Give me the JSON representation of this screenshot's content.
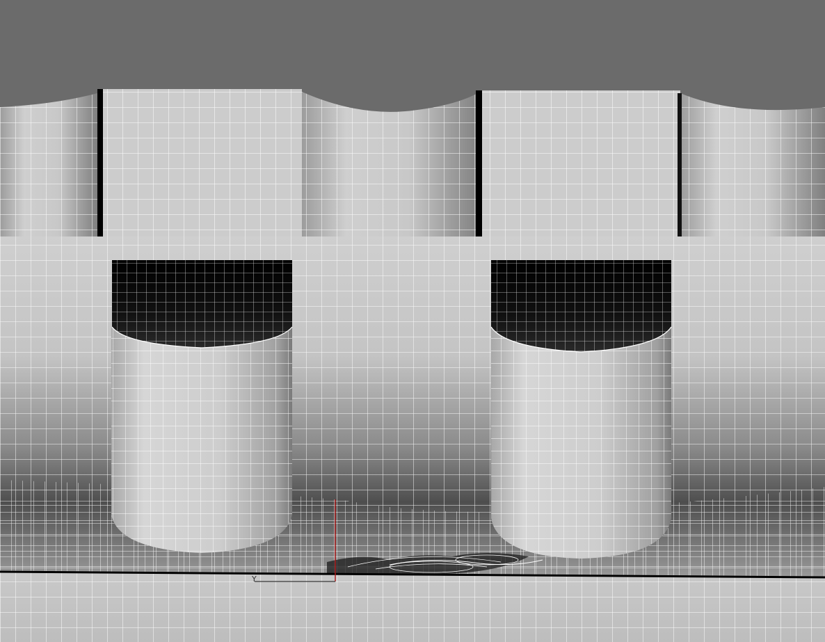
{
  "scene": {
    "colors": {
      "background": "#6b6b6b",
      "surface_light": "#d2d2d2",
      "surface_mid": "#bdbdbd",
      "surface_dark": "#5a5a5a",
      "shadow": "#000000",
      "mesh_lines": "#ffffff",
      "axis_vertical": "#b01818",
      "axis_horizontal": "#3a3a3a"
    },
    "cylinders": [
      {
        "id": "left"
      },
      {
        "id": "right"
      }
    ],
    "axis_triad": {
      "label": "Y"
    }
  }
}
